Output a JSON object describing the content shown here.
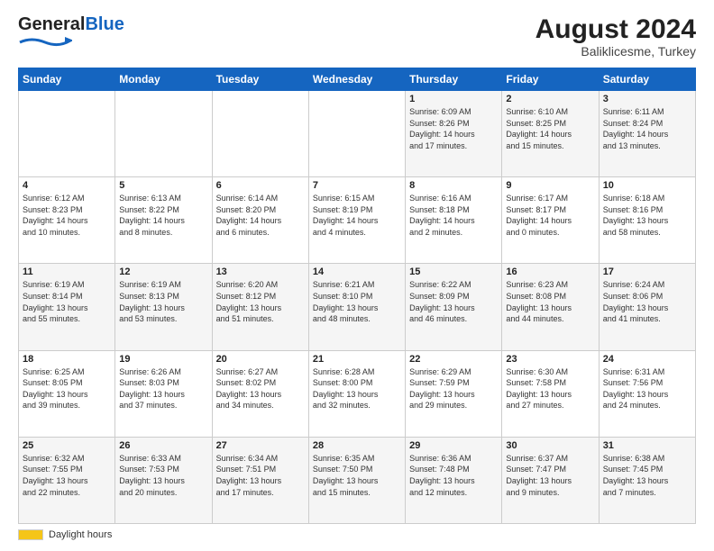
{
  "header": {
    "logo_general": "General",
    "logo_blue": "Blue",
    "month_year": "August 2024",
    "location": "Baliklicesme, Turkey"
  },
  "footer": {
    "label": "Daylight hours"
  },
  "weekdays": [
    "Sunday",
    "Monday",
    "Tuesday",
    "Wednesday",
    "Thursday",
    "Friday",
    "Saturday"
  ],
  "weeks": [
    [
      {
        "day": "",
        "info": ""
      },
      {
        "day": "",
        "info": ""
      },
      {
        "day": "",
        "info": ""
      },
      {
        "day": "",
        "info": ""
      },
      {
        "day": "1",
        "info": "Sunrise: 6:09 AM\nSunset: 8:26 PM\nDaylight: 14 hours\nand 17 minutes."
      },
      {
        "day": "2",
        "info": "Sunrise: 6:10 AM\nSunset: 8:25 PM\nDaylight: 14 hours\nand 15 minutes."
      },
      {
        "day": "3",
        "info": "Sunrise: 6:11 AM\nSunset: 8:24 PM\nDaylight: 14 hours\nand 13 minutes."
      }
    ],
    [
      {
        "day": "4",
        "info": "Sunrise: 6:12 AM\nSunset: 8:23 PM\nDaylight: 14 hours\nand 10 minutes."
      },
      {
        "day": "5",
        "info": "Sunrise: 6:13 AM\nSunset: 8:22 PM\nDaylight: 14 hours\nand 8 minutes."
      },
      {
        "day": "6",
        "info": "Sunrise: 6:14 AM\nSunset: 8:20 PM\nDaylight: 14 hours\nand 6 minutes."
      },
      {
        "day": "7",
        "info": "Sunrise: 6:15 AM\nSunset: 8:19 PM\nDaylight: 14 hours\nand 4 minutes."
      },
      {
        "day": "8",
        "info": "Sunrise: 6:16 AM\nSunset: 8:18 PM\nDaylight: 14 hours\nand 2 minutes."
      },
      {
        "day": "9",
        "info": "Sunrise: 6:17 AM\nSunset: 8:17 PM\nDaylight: 14 hours\nand 0 minutes."
      },
      {
        "day": "10",
        "info": "Sunrise: 6:18 AM\nSunset: 8:16 PM\nDaylight: 13 hours\nand 58 minutes."
      }
    ],
    [
      {
        "day": "11",
        "info": "Sunrise: 6:19 AM\nSunset: 8:14 PM\nDaylight: 13 hours\nand 55 minutes."
      },
      {
        "day": "12",
        "info": "Sunrise: 6:19 AM\nSunset: 8:13 PM\nDaylight: 13 hours\nand 53 minutes."
      },
      {
        "day": "13",
        "info": "Sunrise: 6:20 AM\nSunset: 8:12 PM\nDaylight: 13 hours\nand 51 minutes."
      },
      {
        "day": "14",
        "info": "Sunrise: 6:21 AM\nSunset: 8:10 PM\nDaylight: 13 hours\nand 48 minutes."
      },
      {
        "day": "15",
        "info": "Sunrise: 6:22 AM\nSunset: 8:09 PM\nDaylight: 13 hours\nand 46 minutes."
      },
      {
        "day": "16",
        "info": "Sunrise: 6:23 AM\nSunset: 8:08 PM\nDaylight: 13 hours\nand 44 minutes."
      },
      {
        "day": "17",
        "info": "Sunrise: 6:24 AM\nSunset: 8:06 PM\nDaylight: 13 hours\nand 41 minutes."
      }
    ],
    [
      {
        "day": "18",
        "info": "Sunrise: 6:25 AM\nSunset: 8:05 PM\nDaylight: 13 hours\nand 39 minutes."
      },
      {
        "day": "19",
        "info": "Sunrise: 6:26 AM\nSunset: 8:03 PM\nDaylight: 13 hours\nand 37 minutes."
      },
      {
        "day": "20",
        "info": "Sunrise: 6:27 AM\nSunset: 8:02 PM\nDaylight: 13 hours\nand 34 minutes."
      },
      {
        "day": "21",
        "info": "Sunrise: 6:28 AM\nSunset: 8:00 PM\nDaylight: 13 hours\nand 32 minutes."
      },
      {
        "day": "22",
        "info": "Sunrise: 6:29 AM\nSunset: 7:59 PM\nDaylight: 13 hours\nand 29 minutes."
      },
      {
        "day": "23",
        "info": "Sunrise: 6:30 AM\nSunset: 7:58 PM\nDaylight: 13 hours\nand 27 minutes."
      },
      {
        "day": "24",
        "info": "Sunrise: 6:31 AM\nSunset: 7:56 PM\nDaylight: 13 hours\nand 24 minutes."
      }
    ],
    [
      {
        "day": "25",
        "info": "Sunrise: 6:32 AM\nSunset: 7:55 PM\nDaylight: 13 hours\nand 22 minutes."
      },
      {
        "day": "26",
        "info": "Sunrise: 6:33 AM\nSunset: 7:53 PM\nDaylight: 13 hours\nand 20 minutes."
      },
      {
        "day": "27",
        "info": "Sunrise: 6:34 AM\nSunset: 7:51 PM\nDaylight: 13 hours\nand 17 minutes."
      },
      {
        "day": "28",
        "info": "Sunrise: 6:35 AM\nSunset: 7:50 PM\nDaylight: 13 hours\nand 15 minutes."
      },
      {
        "day": "29",
        "info": "Sunrise: 6:36 AM\nSunset: 7:48 PM\nDaylight: 13 hours\nand 12 minutes."
      },
      {
        "day": "30",
        "info": "Sunrise: 6:37 AM\nSunset: 7:47 PM\nDaylight: 13 hours\nand 9 minutes."
      },
      {
        "day": "31",
        "info": "Sunrise: 6:38 AM\nSunset: 7:45 PM\nDaylight: 13 hours\nand 7 minutes."
      }
    ]
  ]
}
